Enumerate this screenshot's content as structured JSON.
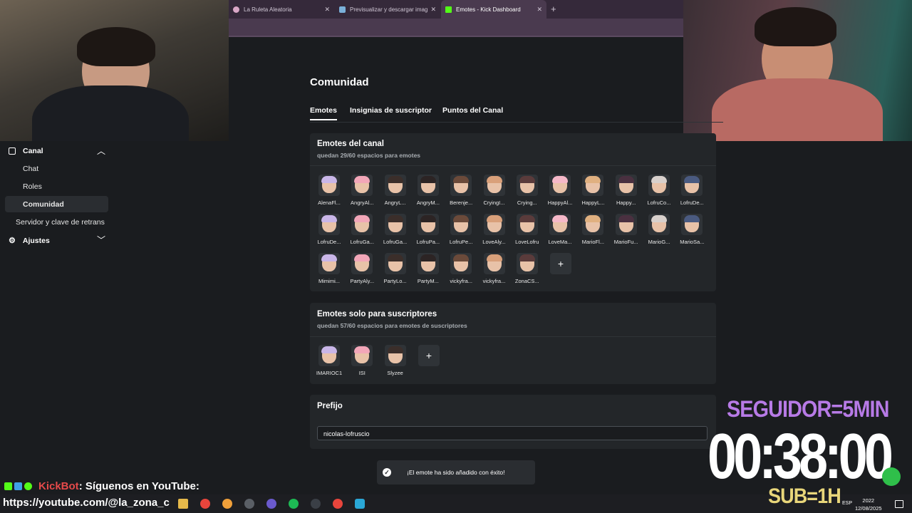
{
  "browser": {
    "tabs": [
      {
        "label": "La Ruleta Aleatoria",
        "active": false
      },
      {
        "label": "Previsualizar y descargar imag",
        "active": false
      },
      {
        "label": "Emotes - Kick Dashboard",
        "active": true
      }
    ],
    "new_tab": "+"
  },
  "sidebar": {
    "canal": "Canal",
    "items": [
      "Chat",
      "Roles",
      "Comunidad",
      "Servidor y clave de retrans"
    ],
    "ajustes": "Ajustes"
  },
  "page": {
    "title": "Comunidad",
    "tabs": [
      "Emotes",
      "Insignias de suscriptor",
      "Puntos del Canal"
    ]
  },
  "channel_emotes": {
    "title": "Emotes del canal",
    "subtitle": "quedan 29/60 espacios para emotes",
    "items": [
      "AlenaFl...",
      "AngryAl...",
      "AngryL...",
      "AngryM...",
      "Berenje...",
      "CryingI...",
      "Crying...",
      "HappyAl...",
      "HappyL...",
      "Happy...",
      "LofruCo...",
      "LofruDe...",
      "LofruDe...",
      "LofruGa...",
      "LofruGa...",
      "LofruPa...",
      "LofruPe...",
      "LoveAly...",
      "LoveLofru",
      "LoveMa...",
      "MarioFl...",
      "MarioFu...",
      "MarioG...",
      "MarioSa...",
      "Mimimi...",
      "PartyAly...",
      "PartyLo...",
      "PartyM...",
      "vickyfra...",
      "vickyfra...",
      "ZonaCS..."
    ],
    "add": "+"
  },
  "sub_emotes": {
    "title": "Emotes solo para suscriptores",
    "subtitle": "quedan 57/60 espacios para emotes de suscriptores",
    "items": [
      "IMARIOC1",
      "ISI",
      "Slyzee"
    ],
    "add": "+"
  },
  "prefix": {
    "title": "Prefijo",
    "value": "nicolas-lofruscio"
  },
  "toast": {
    "message": "¡El emote ha sido añadido con éxito!"
  },
  "overlay": {
    "seguidor": "SEGUIDOR=5MIN",
    "timer": "00:38:00",
    "sub": "SUB=1H",
    "chat_user": "KickBot",
    "chat_text": ": Síguenos en YouTube:",
    "chat_link": "https://youtube.com/@la_zona_c"
  },
  "taskbar": {
    "lang": "ESP",
    "time": "2022",
    "date": "12/08/2025"
  },
  "colors": {
    "accent_kick": "#53fc18",
    "toast_bg": "#2a2d31",
    "seguidor": "#b77ae6",
    "sub": "#e8d67a",
    "bot_name": "#e64a4a"
  }
}
